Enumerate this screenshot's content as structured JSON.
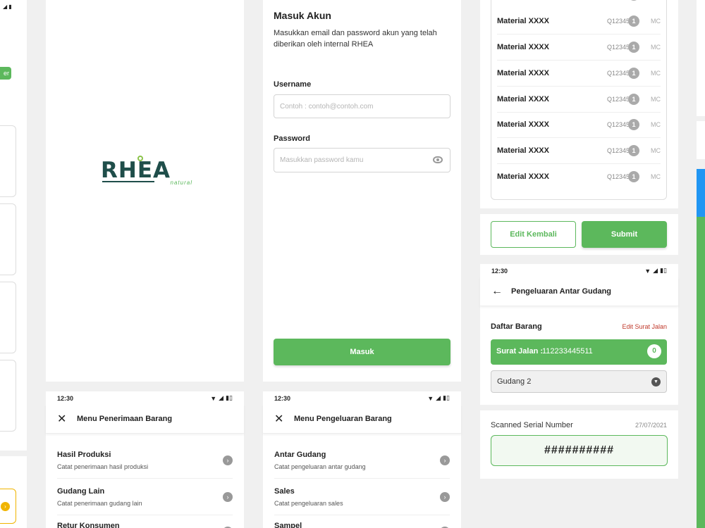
{
  "left_partial": {
    "button_fragment": "er"
  },
  "splash": {
    "logo_main": "RHEA",
    "logo_sub": "natural"
  },
  "login": {
    "title": "Masuk Akun",
    "description": "Masukkan email dan password akun yang telah diberikan oleh internal RHEA",
    "username_label": "Username",
    "username_placeholder": "Contoh : contoh@contoh.com",
    "password_label": "Password",
    "password_placeholder": "Masukkan password kamu",
    "submit_label": "Masuk"
  },
  "status_bar": {
    "time": "12:30"
  },
  "penerimaan": {
    "title": "Menu Penerimaan Barang",
    "items": [
      {
        "title": "Hasil Produksi",
        "subtitle": "Catat penerimaan hasil produksi"
      },
      {
        "title": "Gudang Lain",
        "subtitle": "Catat penerimaan gudang lain"
      },
      {
        "title": "Retur Konsumen",
        "subtitle": ""
      }
    ]
  },
  "pengeluaran": {
    "title": "Menu Pengeluaran Barang",
    "items": [
      {
        "title": "Antar Gudang",
        "subtitle": "Catat pengeluaran antar gudang"
      },
      {
        "title": "Sales",
        "subtitle": "Catat pengeluaran sales"
      },
      {
        "title": "Sampel",
        "subtitle": ""
      }
    ]
  },
  "materials": {
    "rows": [
      {
        "name": "Material XXXX",
        "code": "Q12345",
        "qty": "1",
        "unit": "MC"
      },
      {
        "name": "Material XXXX",
        "code": "Q12345",
        "qty": "1",
        "unit": "MC"
      },
      {
        "name": "Material XXXX",
        "code": "Q12345",
        "qty": "1",
        "unit": "MC"
      },
      {
        "name": "Material XXXX",
        "code": "Q12345",
        "qty": "1",
        "unit": "MC"
      },
      {
        "name": "Material XXXX",
        "code": "Q12345",
        "qty": "1",
        "unit": "MC"
      },
      {
        "name": "Material XXXX",
        "code": "Q12345",
        "qty": "1",
        "unit": "MC"
      },
      {
        "name": "Material XXXX",
        "code": "Q12345",
        "qty": "1",
        "unit": "MC"
      }
    ],
    "edit_label": "Edit Kembali",
    "submit_label": "Submit"
  },
  "antar_gudang": {
    "title": "Pengeluaran Antar Gudang",
    "section_title": "Daftar Barang",
    "edit_link": "Edit Surat Jalan",
    "surat_jalan_label": "Surat Jalan :",
    "surat_jalan_number": "112233445511",
    "count": "0",
    "gudang": "Gudang 2",
    "scanned_label": "Scanned Serial Number",
    "scanned_date": "27/07/2021",
    "serial_value": "##########"
  },
  "colors": {
    "brand_green": "#5cb85c",
    "logo_dark": "#1f4e4a",
    "edit_red": "#c0392b"
  }
}
